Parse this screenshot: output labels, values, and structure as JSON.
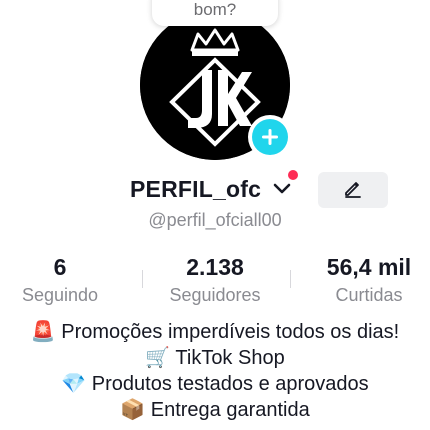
{
  "tooltip": {
    "text": "bom?"
  },
  "profile": {
    "avatar_logo_text": "JK",
    "username": "PERFIL_ofc",
    "handle": "@perfil_ofciall00",
    "edit_icon": "pencil-icon",
    "add_icon": "plus-icon"
  },
  "stats": [
    {
      "value": "6",
      "label": "Seguindo"
    },
    {
      "value": "2.138",
      "label": "Seguidores"
    },
    {
      "value": "56,4 mil",
      "label": "Curtidas"
    }
  ],
  "bio": [
    "🚨 Promoções imperdíveis todos os dias!",
    "🛒 TikTok Shop",
    "💎 Produtos testados e aprovados",
    "📦 Entrega garantida"
  ],
  "colors": {
    "accent_add": "#20d5ec",
    "notification": "#fe2c55",
    "secondary_text": "#8a8b91"
  }
}
